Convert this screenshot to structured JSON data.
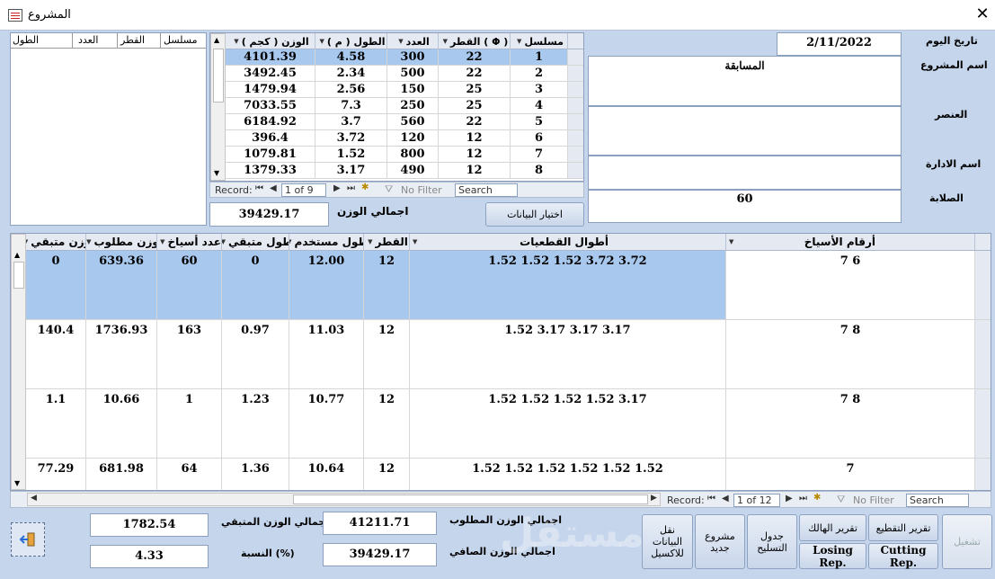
{
  "window": {
    "title": "المشروع",
    "close": "✕"
  },
  "side_list": {
    "headers": [
      "الطول",
      "العدد",
      "القطر",
      "مسلسل"
    ]
  },
  "top_grid": {
    "headers": [
      "الوزن ( كجم )",
      "الطول ( م )",
      "العدد",
      "القطر ( Φ )",
      "مسلسل"
    ],
    "rows": [
      [
        "4101.39",
        "4.58",
        "300",
        "22",
        "1"
      ],
      [
        "3492.45",
        "2.34",
        "500",
        "22",
        "2"
      ],
      [
        "1479.94",
        "2.56",
        "150",
        "25",
        "3"
      ],
      [
        "7033.55",
        "7.3",
        "250",
        "25",
        "4"
      ],
      [
        "6184.92",
        "3.7",
        "560",
        "22",
        "5"
      ],
      [
        "396.4",
        "3.72",
        "120",
        "12",
        "6"
      ],
      [
        "1079.81",
        "1.52",
        "800",
        "12",
        "7"
      ],
      [
        "1379.33",
        "3.17",
        "490",
        "12",
        "8"
      ]
    ],
    "nav": {
      "record_label": "Record:",
      "position": "1 of 9",
      "filter": "No Filter",
      "search": "Search"
    }
  },
  "totals_top": {
    "label": "اجمالي الوزن",
    "value": "39429.17"
  },
  "select_button": "اختيار البيانات",
  "project_info": {
    "date_label": "تاريخ اليوم",
    "date": "2/11/2022",
    "project_label": "اسم المشروع",
    "project": "المسابقة",
    "element_label": "العنصر",
    "element": "",
    "admin_label": "اسم الادارة",
    "admin": "",
    "hardness_label": "الصلابة",
    "hardness": "60"
  },
  "main_grid": {
    "headers": [
      "وزن متبقي",
      "وزن مطلوب",
      "عدد أسياخ",
      "طول متبقي",
      "طول مستخدم",
      "القطر",
      "أطوال القطعيات",
      "أرقام الأسياخ"
    ],
    "rows": [
      [
        "0",
        "639.36",
        "60",
        "0",
        "12.00",
        "12",
        "1.52 1.52 1.52 3.72 3.72",
        "7 6"
      ],
      [
        "140.4",
        "1736.93",
        "163",
        "0.97",
        "11.03",
        "12",
        "1.52 3.17 3.17 3.17",
        "7 8"
      ],
      [
        "1.1",
        "10.66",
        "1",
        "1.23",
        "10.77",
        "12",
        "1.52 1.52 1.52 1.52 3.17",
        "7 8"
      ],
      [
        "77.29",
        "681.98",
        "64",
        "1.36",
        "10.64",
        "12",
        "1.52 1.52 1.52 1.52 1.52 1.52",
        "7"
      ]
    ],
    "nav": {
      "record_label": "Record:",
      "position": "1 of 12",
      "filter": "No Filter",
      "search": "Search"
    }
  },
  "summary": {
    "remaining_weight_label": "اجمالي الوزن المتبقي",
    "remaining_weight": "1782.54",
    "ratio_label": "النسبة (%)",
    "ratio": "4.33",
    "required_weight_label": "اجمالي الوزن المطلوب",
    "required_weight": "41211.71",
    "net_weight_label": "اجمالي الوزن الصافي",
    "net_weight": "39429.17"
  },
  "buttons": {
    "export_excel": "نقل البيانات للاكسيل",
    "new_project": "مشروع جديد",
    "rebar_table": "جدول التسليح",
    "waste_report": "تقرير الهالك",
    "cutting_report": "تقرير التقطيع",
    "losing_rep": "Losing Rep.",
    "cutting_rep": "Cutting Rep.",
    "run": "تشغيل"
  },
  "watermark": "مستقل"
}
